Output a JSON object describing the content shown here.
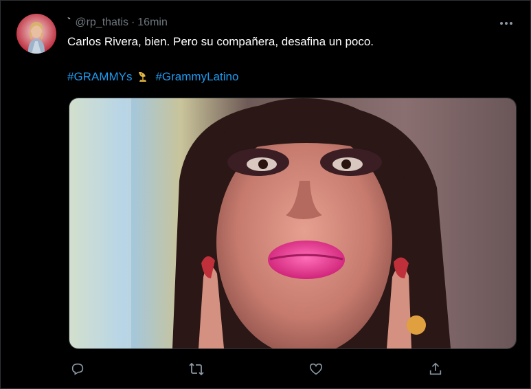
{
  "tweet": {
    "prefix_mark": "`",
    "handle": "@rp_thatis",
    "separator": "·",
    "time": "16min",
    "text": "Carlos Rivera, bien. Pero su compañera, desafina un poco.",
    "hashtags": [
      "#GRAMMYs",
      "#GrammyLatino"
    ]
  },
  "icons": {
    "more": "more-horizontal-icon",
    "reply": "reply-icon",
    "retweet": "retweet-icon",
    "like": "heart-icon",
    "share": "share-icon",
    "grammy": "grammy-gramophone-icon"
  },
  "colors": {
    "background": "#000000",
    "text": "#ffffff",
    "muted": "#6e767d",
    "link": "#1d9bf0",
    "border": "#2f3336"
  }
}
